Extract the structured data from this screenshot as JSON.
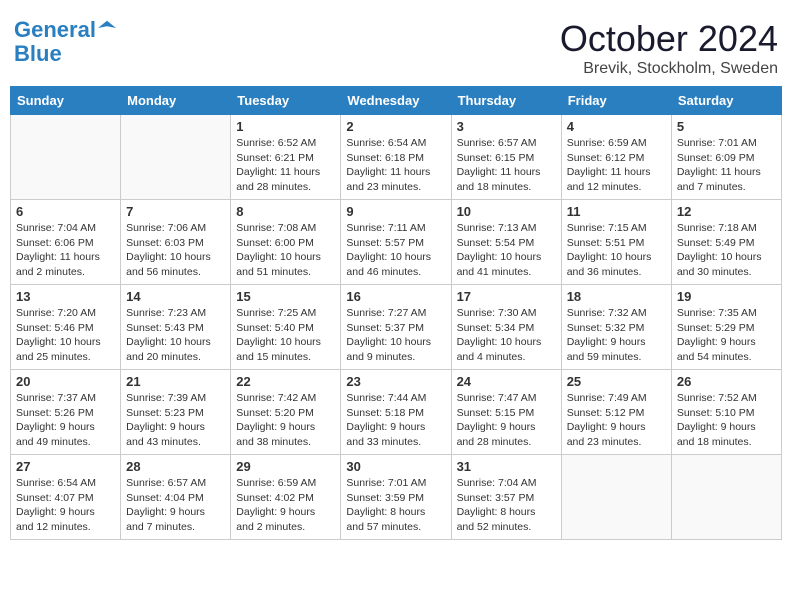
{
  "header": {
    "logo_line1": "General",
    "logo_line2": "Blue",
    "month": "October 2024",
    "location": "Brevik, Stockholm, Sweden"
  },
  "days_of_week": [
    "Sunday",
    "Monday",
    "Tuesday",
    "Wednesday",
    "Thursday",
    "Friday",
    "Saturday"
  ],
  "weeks": [
    [
      {
        "day": "",
        "info": ""
      },
      {
        "day": "",
        "info": ""
      },
      {
        "day": "1",
        "info": "Sunrise: 6:52 AM\nSunset: 6:21 PM\nDaylight: 11 hours and 28 minutes."
      },
      {
        "day": "2",
        "info": "Sunrise: 6:54 AM\nSunset: 6:18 PM\nDaylight: 11 hours and 23 minutes."
      },
      {
        "day": "3",
        "info": "Sunrise: 6:57 AM\nSunset: 6:15 PM\nDaylight: 11 hours and 18 minutes."
      },
      {
        "day": "4",
        "info": "Sunrise: 6:59 AM\nSunset: 6:12 PM\nDaylight: 11 hours and 12 minutes."
      },
      {
        "day": "5",
        "info": "Sunrise: 7:01 AM\nSunset: 6:09 PM\nDaylight: 11 hours and 7 minutes."
      }
    ],
    [
      {
        "day": "6",
        "info": "Sunrise: 7:04 AM\nSunset: 6:06 PM\nDaylight: 11 hours and 2 minutes."
      },
      {
        "day": "7",
        "info": "Sunrise: 7:06 AM\nSunset: 6:03 PM\nDaylight: 10 hours and 56 minutes."
      },
      {
        "day": "8",
        "info": "Sunrise: 7:08 AM\nSunset: 6:00 PM\nDaylight: 10 hours and 51 minutes."
      },
      {
        "day": "9",
        "info": "Sunrise: 7:11 AM\nSunset: 5:57 PM\nDaylight: 10 hours and 46 minutes."
      },
      {
        "day": "10",
        "info": "Sunrise: 7:13 AM\nSunset: 5:54 PM\nDaylight: 10 hours and 41 minutes."
      },
      {
        "day": "11",
        "info": "Sunrise: 7:15 AM\nSunset: 5:51 PM\nDaylight: 10 hours and 36 minutes."
      },
      {
        "day": "12",
        "info": "Sunrise: 7:18 AM\nSunset: 5:49 PM\nDaylight: 10 hours and 30 minutes."
      }
    ],
    [
      {
        "day": "13",
        "info": "Sunrise: 7:20 AM\nSunset: 5:46 PM\nDaylight: 10 hours and 25 minutes."
      },
      {
        "day": "14",
        "info": "Sunrise: 7:23 AM\nSunset: 5:43 PM\nDaylight: 10 hours and 20 minutes."
      },
      {
        "day": "15",
        "info": "Sunrise: 7:25 AM\nSunset: 5:40 PM\nDaylight: 10 hours and 15 minutes."
      },
      {
        "day": "16",
        "info": "Sunrise: 7:27 AM\nSunset: 5:37 PM\nDaylight: 10 hours and 9 minutes."
      },
      {
        "day": "17",
        "info": "Sunrise: 7:30 AM\nSunset: 5:34 PM\nDaylight: 10 hours and 4 minutes."
      },
      {
        "day": "18",
        "info": "Sunrise: 7:32 AM\nSunset: 5:32 PM\nDaylight: 9 hours and 59 minutes."
      },
      {
        "day": "19",
        "info": "Sunrise: 7:35 AM\nSunset: 5:29 PM\nDaylight: 9 hours and 54 minutes."
      }
    ],
    [
      {
        "day": "20",
        "info": "Sunrise: 7:37 AM\nSunset: 5:26 PM\nDaylight: 9 hours and 49 minutes."
      },
      {
        "day": "21",
        "info": "Sunrise: 7:39 AM\nSunset: 5:23 PM\nDaylight: 9 hours and 43 minutes."
      },
      {
        "day": "22",
        "info": "Sunrise: 7:42 AM\nSunset: 5:20 PM\nDaylight: 9 hours and 38 minutes."
      },
      {
        "day": "23",
        "info": "Sunrise: 7:44 AM\nSunset: 5:18 PM\nDaylight: 9 hours and 33 minutes."
      },
      {
        "day": "24",
        "info": "Sunrise: 7:47 AM\nSunset: 5:15 PM\nDaylight: 9 hours and 28 minutes."
      },
      {
        "day": "25",
        "info": "Sunrise: 7:49 AM\nSunset: 5:12 PM\nDaylight: 9 hours and 23 minutes."
      },
      {
        "day": "26",
        "info": "Sunrise: 7:52 AM\nSunset: 5:10 PM\nDaylight: 9 hours and 18 minutes."
      }
    ],
    [
      {
        "day": "27",
        "info": "Sunrise: 6:54 AM\nSunset: 4:07 PM\nDaylight: 9 hours and 12 minutes."
      },
      {
        "day": "28",
        "info": "Sunrise: 6:57 AM\nSunset: 4:04 PM\nDaylight: 9 hours and 7 minutes."
      },
      {
        "day": "29",
        "info": "Sunrise: 6:59 AM\nSunset: 4:02 PM\nDaylight: 9 hours and 2 minutes."
      },
      {
        "day": "30",
        "info": "Sunrise: 7:01 AM\nSunset: 3:59 PM\nDaylight: 8 hours and 57 minutes."
      },
      {
        "day": "31",
        "info": "Sunrise: 7:04 AM\nSunset: 3:57 PM\nDaylight: 8 hours and 52 minutes."
      },
      {
        "day": "",
        "info": ""
      },
      {
        "day": "",
        "info": ""
      }
    ]
  ]
}
